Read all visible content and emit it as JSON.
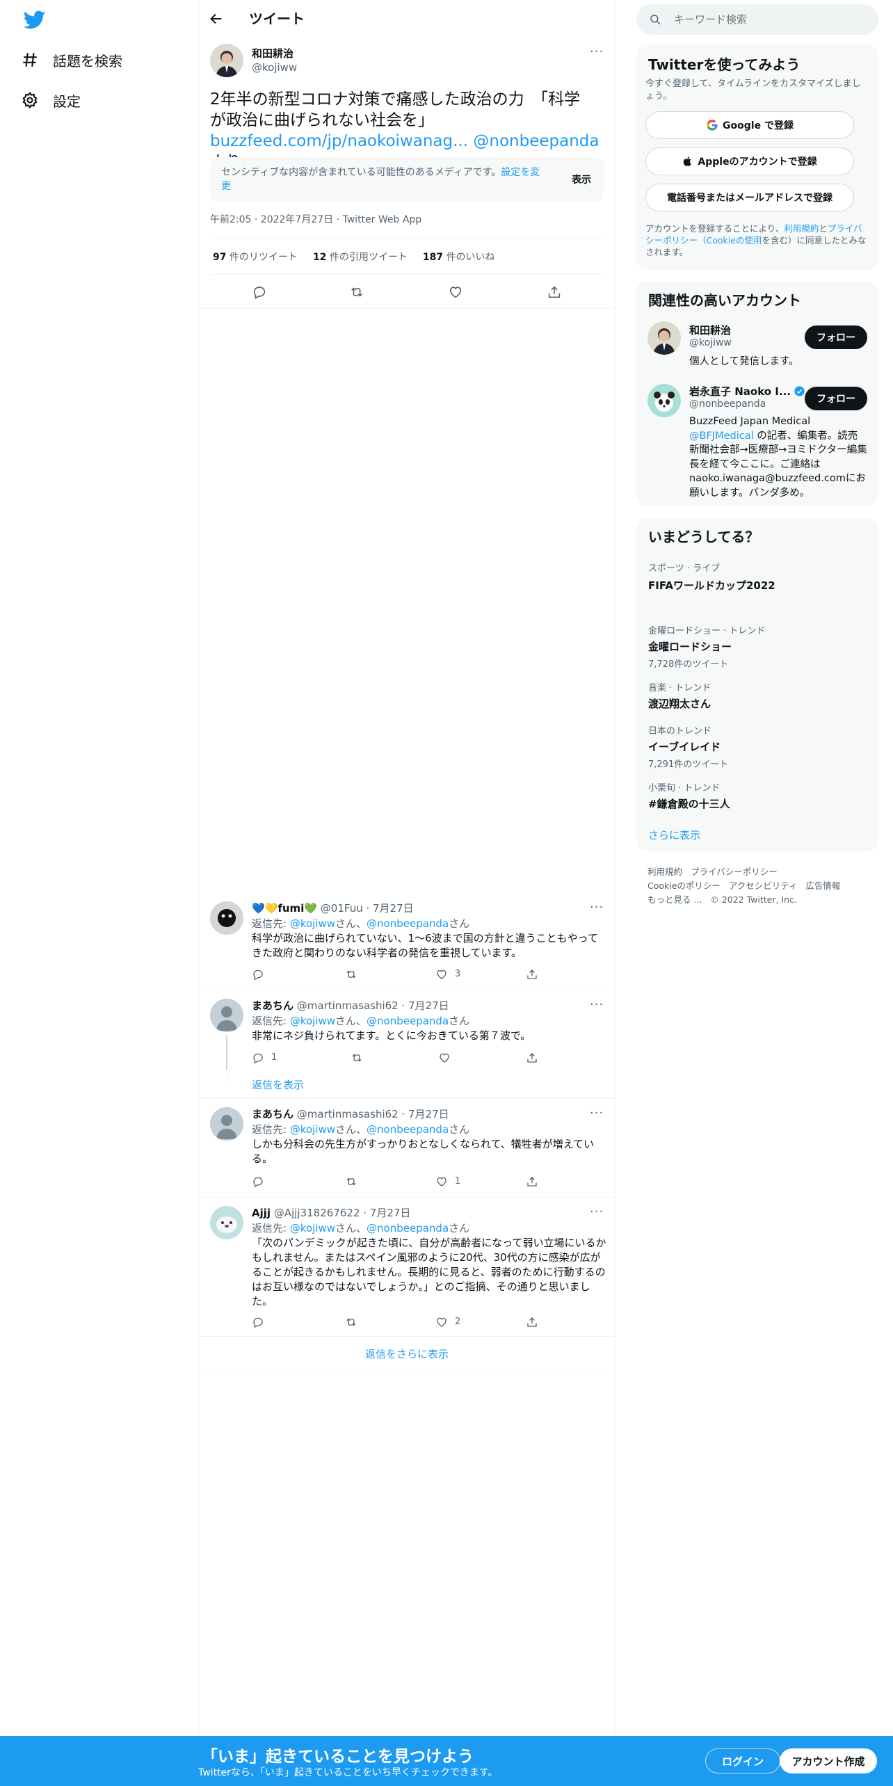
{
  "nav": {
    "explore": "話題を検索",
    "settings": "設定"
  },
  "header": {
    "title": "ツイート"
  },
  "tweet": {
    "name": "和田耕治",
    "handle": "@kojiww",
    "text_line1": "2年半の新型コロナ対策で痛感した政治の力　「科学",
    "text_line2": "が政治に曲げられない社会を」",
    "link": "buzzfeed.com/jp/naokoiwanag...",
    "mention": "@nonbeepanda",
    "text_suffix": "より",
    "sensitive_text": "センシティブな内容が含まれている可能性のあるメディアです。",
    "sensitive_link": "設定を変更",
    "show_label": "表示",
    "meta": "午前2:05 · 2022年7月27日 · Twitter Web App",
    "retweets_count": "97",
    "retweets_label": "件のリツイート",
    "quotes_count": "12",
    "quotes_label": "件の引用ツイート",
    "likes_count": "187",
    "likes_label": "件のいいね"
  },
  "replies": [
    {
      "name": "💙💛fumi💚",
      "handle": "@01Fuu · 7月27日",
      "reply_prefix": "返信先: ",
      "to1": "@kojiww",
      "san1": "さん、",
      "to2": "@nonbeepanda",
      "san2": "さん",
      "text": "科学が政治に曲げられていない、1～6波まで国の方針と違うこともやってきた政府と関わりのない科学者の発信を重視しています。",
      "reply_count": "",
      "like_count": "3"
    },
    {
      "name": "まあちん",
      "handle": "@martinmasashi62 · 7月27日",
      "reply_prefix": "返信先: ",
      "to1": "@kojiww",
      "san1": "さん、",
      "to2": "@nonbeepanda",
      "san2": "さん",
      "text": "非常にネジ負けられてます。とくに今おきている第７波で。",
      "reply_count": "1",
      "like_count": "",
      "show_replies": "返信を表示"
    },
    {
      "name": "まあちん",
      "handle": "@martinmasashi62 · 7月27日",
      "reply_prefix": "返信先: ",
      "to1": "@kojiww",
      "san1": "さん、",
      "to2": "@nonbeepanda",
      "san2": "さん",
      "text": "しかも分科会の先生方がすっかりおとなしくなられて、犠牲者が増えている。",
      "reply_count": "",
      "like_count": "1"
    },
    {
      "name": "Ajjj",
      "handle": "@Ajjj318267622 · 7月27日",
      "reply_prefix": "返信先: ",
      "to1": "@kojiww",
      "san1": "さん、",
      "to2": "@nonbeepanda",
      "san2": "さん",
      "text": "「次のパンデミックが起きた頃に、自分が高齢者になって弱い立場にいるかもしれません。またはスペイン風邪のように20代、30代の方に感染が広がることが起きるかもしれません。長期的に見ると、弱者のために行動するのはお互い様なのではないでしょうか。」とのご指摘、その通りと思いました。",
      "reply_count": "",
      "like_count": "2"
    }
  ],
  "more_replies": "返信をさらに表示",
  "search": {
    "placeholder": "キーワード検索"
  },
  "signup": {
    "title": "Twitterを使ってみよう",
    "subtitle": "今すぐ登録して、タイムラインをカスタマイズしましょう。",
    "google": "Google で登録",
    "apple": "Appleのアカウントで登録",
    "email": "電話番号またはメールアドレスで登録",
    "terms_pre": "アカウントを登録することにより、",
    "terms_link": "利用規約",
    "terms_and": "と",
    "privacy_link": "プライバシーポリシー",
    "cookie_link": "（Cookieの使用",
    "terms_post": "を含む）に同意したとみなされます。"
  },
  "related": {
    "title": "関連性の高いアカウント",
    "follow": "フォロー",
    "accounts": [
      {
        "name": "和田耕治",
        "handle": "@kojiww",
        "bio": "個人として発信します。"
      },
      {
        "name": "岩永直子 Naoko I...",
        "handle": "@nonbeepanda",
        "bio1": "BuzzFeed Japan Medical ",
        "bio_link": "@BFJMedical",
        "bio2": " の記者、編集者。読売新聞社会部→医療部→ヨミドクター編集長を経て今ここに。ご連絡はnaoko.iwanaga@buzzfeed.comにお願いします。パンダ多め。"
      }
    ]
  },
  "trends": {
    "title": "いまどうしてる？",
    "items": [
      {
        "category": "スポーツ · ライブ",
        "name": "FIFAワールドカップ2022",
        "count": ""
      },
      {
        "category": "金曜ロードショー · トレンド",
        "name": "金曜ロードショー",
        "count": "7,728件のツイート"
      },
      {
        "category": "音楽 · トレンド",
        "name": "渡辺翔太さん",
        "count": ""
      },
      {
        "category": "日本のトレンド",
        "name": "イーブイレイド",
        "count": "7,291件のツイート"
      },
      {
        "category": "小栗旬 · トレンド",
        "name": "#鎌倉殿の十三人",
        "count": ""
      }
    ],
    "show_more": "さらに表示"
  },
  "footer": {
    "l1a": "利用規約",
    "l1b": "プライバシーポリシー",
    "l2a": "Cookieのポリシー",
    "l2b": "アクセシビリティ",
    "l2c": "広告情報",
    "l3a": "もっと見る ...",
    "l3b": "© 2022 Twitter, Inc."
  },
  "bottom_bar": {
    "title": "「いま」起きていることを見つけよう",
    "subtitle": "Twitterなら、「いま」起きていることをいち早くチェックできます。",
    "login": "ログイン",
    "signup": "アカウント作成"
  },
  "colors": {
    "accent": "#1d9bf0",
    "text": "#0f1419",
    "secondary": "#536471"
  }
}
